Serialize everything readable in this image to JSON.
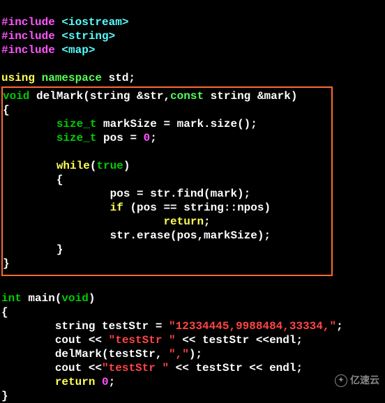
{
  "includes": {
    "l1": {
      "directive": "#include ",
      "header": "<iostream>"
    },
    "l2": {
      "directive": "#include ",
      "header": "<string>"
    },
    "l3": {
      "directive": "#include ",
      "header": "<map>"
    }
  },
  "using_line": {
    "using": "using ",
    "namespace": "namespace ",
    "rest": "std;"
  },
  "delmark": {
    "sig": {
      "void": "void ",
      "name": "delMark(string &str,",
      "const": "const ",
      "tail": "string &mark)"
    },
    "brace_open": "{",
    "size_line": {
      "indent": "        ",
      "type": "size_t ",
      "rest": "markSize = mark.size();"
    },
    "pos_line": {
      "indent": "        ",
      "type": "size_t ",
      "name": "pos = ",
      "zero": "0",
      "semi": ";"
    },
    "while_line": {
      "indent": "        ",
      "while": "while",
      "paren_open": "(",
      "true": "true",
      "paren_close": ")"
    },
    "inner_open": "        {",
    "find_line": {
      "indent": "                ",
      "text": "pos = str.find(mark);"
    },
    "if_line": {
      "indent": "                ",
      "if": "if ",
      "cond": "(pos == string::npos)"
    },
    "return_line": {
      "indent": "                        ",
      "return": "return",
      "semi": ";"
    },
    "erase_line": {
      "indent": "                ",
      "text": "str.erase(pos,markSize);"
    },
    "inner_close": "        }",
    "brace_close": "}"
  },
  "main": {
    "sig": {
      "int": "int ",
      "name": "main(",
      "void": "void",
      "close": ")"
    },
    "brace_open": "{",
    "teststr_line": {
      "indent": "        ",
      "decl": "string testStr = ",
      "lit": "\"12334445,9988484,33334,\"",
      "semi": ";"
    },
    "cout1": {
      "indent": "        ",
      "pre": "cout << ",
      "lit": "\"testStr \"",
      "post": " << testStr <<endl;"
    },
    "call": {
      "indent": "        ",
      "pre": "delMark(testStr, ",
      "lit": "\",\"",
      "post": ");"
    },
    "cout2": {
      "indent": "        ",
      "pre": "cout <<",
      "lit": "\"testStr \"",
      "post": " << testStr << endl;"
    },
    "ret": {
      "indent": "        ",
      "return": "return ",
      "zero": "0",
      "semi": ";"
    },
    "brace_close": "}"
  },
  "watermark": "亿速云"
}
